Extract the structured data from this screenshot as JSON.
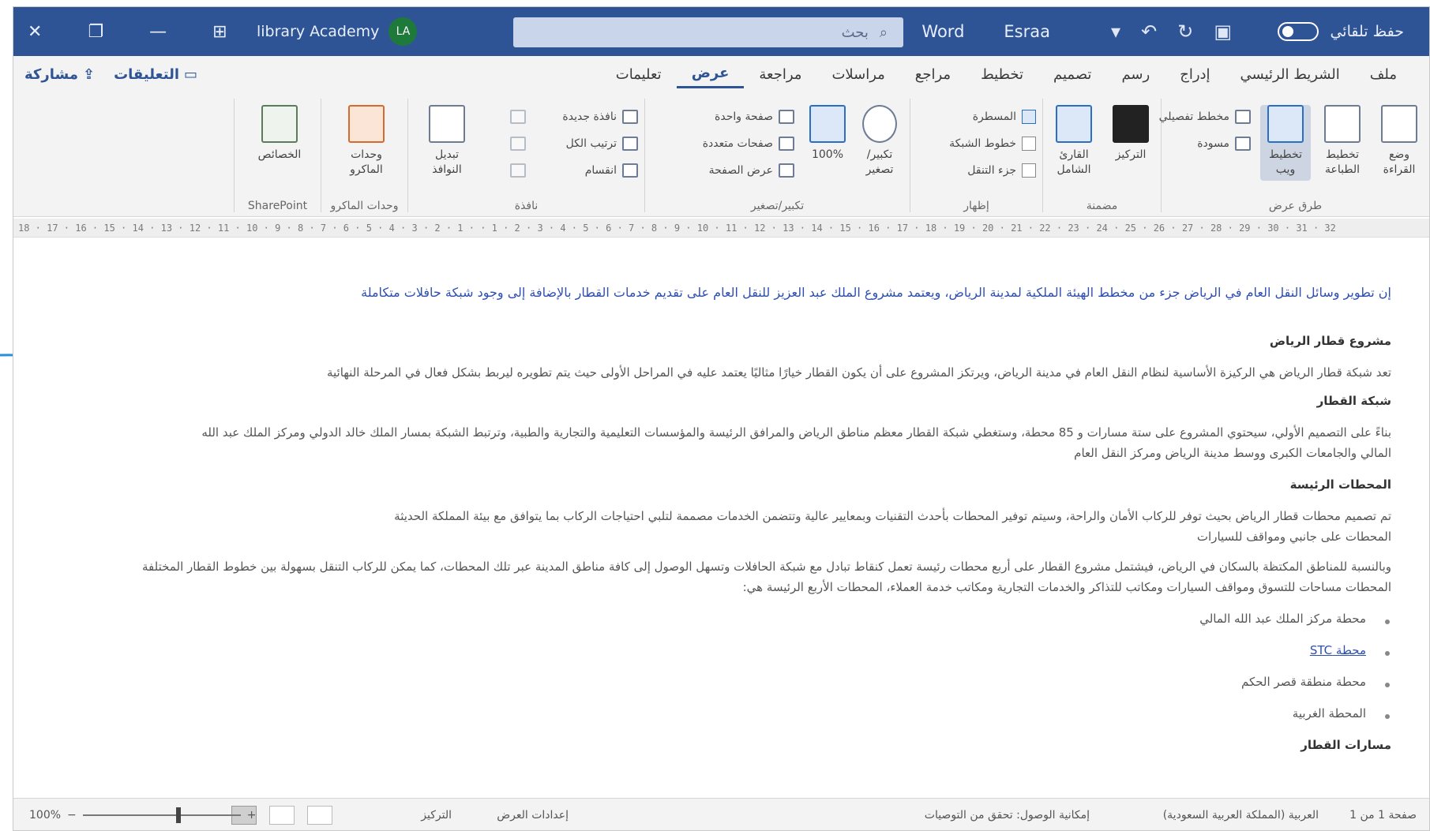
{
  "titlebar": {
    "autosave_label": "حفظ تلقائي",
    "doc_name": "Esraa",
    "app_name": "Word",
    "search_placeholder": "بحث",
    "user_initials": "LA",
    "user_name": "library Academy"
  },
  "tabs": [
    {
      "label": "ملف"
    },
    {
      "label": "الشريط الرئيسي"
    },
    {
      "label": "إدراج"
    },
    {
      "label": "رسم"
    },
    {
      "label": "تصميم"
    },
    {
      "label": "تخطيط"
    },
    {
      "label": "مراجع"
    },
    {
      "label": "مراسلات"
    },
    {
      "label": "مراجعة"
    },
    {
      "label": "عرض",
      "active": true
    },
    {
      "label": "تعليمات"
    }
  ],
  "tabs_right": {
    "comments": "التعليقات",
    "share": "مشاركة"
  },
  "ribbon": {
    "views_group": "طرق عرض",
    "read_mode": "وضع القراءة",
    "print_layout": "تخطيط الطباعة",
    "web_layout": "تخطيط ويب",
    "outline": "مخطط تفصيلي",
    "draft": "مسودة",
    "immersive_group": "مضمنة",
    "focus": "التركيز",
    "immersive_reader": "القارئ الشامل",
    "show_group": "إظهار",
    "ruler": "المسطرة",
    "gridlines": "خطوط الشبكة",
    "nav_pane": "جزء التنقل",
    "zoom_group": "تكبير/تصغير",
    "zoom": "تكبير/تصغير",
    "hundred": "100%",
    "one_page": "صفحة واحدة",
    "multiple_pages": "صفحات متعددة",
    "page_width": "عرض الصفحة",
    "window_group": "نافذة",
    "new_window": "نافذة جديدة",
    "arrange_all": "ترتيب الكل",
    "split": "انقسام",
    "switch_windows": "تبديل النوافذ",
    "macros_group": "وحدات الماكرو",
    "macros": "وحدات الماكرو",
    "sharepoint_group": "SharePoint",
    "properties": "الخصائص"
  },
  "ruler_text": "18 · 17 · 16 · 15 · 14 · 13 · 12 · 11 · 10 · 9 · 8 · 7 · 6 · 5 · 4 · 3 · 2 · 1 · · 1 · 2 · 3 · 4 · 5 · 6 · 7 · 8 · 9 · 10 · 11 · 12 · 13 · 14 · 15 · 16 · 17 · 18 · 19 · 20 · 21 · 22 · 23 · 24 · 25 · 26 · 27 · 28 · 29 · 30 · 31 · 32",
  "document": {
    "title": "إن تطوير وسائل النقل العام في الرياض جزء من مخطط الهيئة الملكية لمدينة الرياض، ويعتمد مشروع الملك عبد العزيز للنقل العام على تقديم خدمات القطار بالإضافة إلى وجود شبكة حافلات متكاملة",
    "h_project": "مشروع قطار الرياض",
    "p_project": "تعد شبكة قطار الرياض هي الركيزة الأساسية لنظام النقل العام في مدينة الرياض، ويرتكز المشروع على أن يكون القطار خيارًا مثاليًا يعتمد عليه في المراحل الأولى حيث يتم تطويره ليربط بشكل فعال في المرحلة النهائية",
    "h_network": "شبكة القطار",
    "p_network_1": "بناءً على التصميم الأولي، سيحتوي المشروع على ستة مسارات و 85 محطة، وستغطي شبكة القطار معظم مناطق الرياض والمرافق الرئيسة والمؤسسات التعليمية والتجارية والطبية، وترتبط الشبكة بمسار الملك خالد الدولي ومركز الملك عبد الله",
    "p_network_2": "المالي والجامعات الكبرى ووسط مدينة الرياض ومركز النقل العام",
    "h_stations": "المحطات الرئيسة",
    "p_stations_1": "تم تصميم محطات قطار الرياض بحيث توفر للركاب الأمان والراحة، وسيتم توفير المحطات بأحدث التقنيات وبمعايير عالية وتتضمن الخدمات مصممة لتلبي احتياجات الركاب بما يتوافق مع بيئة المملكة الحديثة",
    "p_stations_2": "المحطات على جانبي ومواقف للسيارات",
    "p_stations_3": "وبالنسبة للمناطق المكتظة بالسكان في الرياض، فيشتمل مشروع القطار على أربع محطات رئيسة تعمل كنقاط تبادل مع شبكة الحافلات وتسهل الوصول إلى كافة مناطق المدينة عبر تلك المحطات، كما يمكن للركاب التنقل بسهولة بين خطوط القطار المختلفة",
    "p_stations_4": "المحطات مساحات للتسوق ومواقف السيارات ومكاتب للتذاكر والخدمات التجارية ومكاتب خدمة العملاء، المحطات الأربع الرئيسة هي:",
    "bullets": [
      "محطة مركز الملك عبد الله المالي",
      "محطة STC",
      "محطة منطقة قصر الحكم",
      "المحطة الغربية"
    ],
    "h_lines": "مسارات القطار"
  },
  "statusbar": {
    "page": "صفحة 1 من 1",
    "language": "العربية (المملكة العربية السعودية)",
    "accessibility": "إمكانية الوصول: تحقق من التوصيات",
    "focus": "التركيز",
    "display_settings": "إعدادات العرض",
    "zoom_percent": "100%"
  }
}
